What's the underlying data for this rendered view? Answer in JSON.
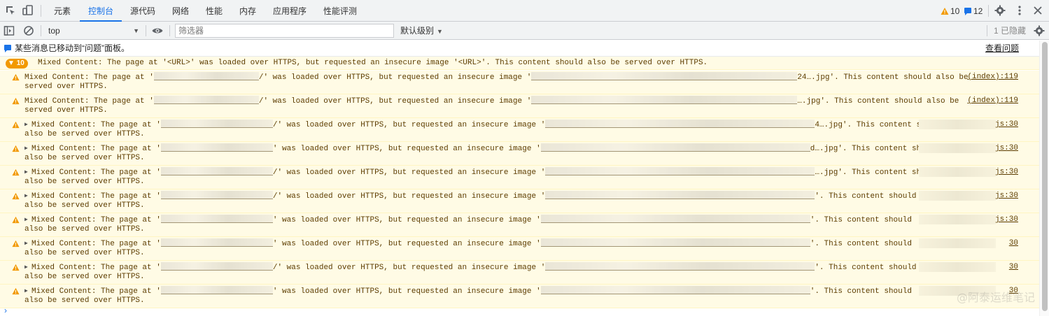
{
  "topbar": {
    "tabs": [
      {
        "label": "元素"
      },
      {
        "label": "控制台"
      },
      {
        "label": "源代码"
      },
      {
        "label": "网络"
      },
      {
        "label": "性能"
      },
      {
        "label": "内存"
      },
      {
        "label": "应用程序"
      },
      {
        "label": "性能评测"
      }
    ],
    "active_tab": "控制台",
    "warnings_count": "10",
    "issues_count": "12",
    "icons": [
      "inspect-icon",
      "device-toggle-icon",
      "warning-icon",
      "issues-flag-icon",
      "gear-icon",
      "kebab-menu-icon",
      "close-icon"
    ],
    "accent_color": "#1a73e8"
  },
  "toolbar": {
    "context": "top",
    "filter_placeholder": "筛选器",
    "levels_label": "默认级别",
    "hidden_label": "1 已隐藏",
    "icons": [
      "sidebar-toggle-icon",
      "clear-console-icon",
      "eye-icon",
      "settings-icon"
    ]
  },
  "info_banner": {
    "message": "某些消息已移动到“问题”面板。",
    "link": "查看问题"
  },
  "group": {
    "badge": "10",
    "text": "Mixed Content: The page at '<URL>' was loaded over HTTPS, but requested an insecure image '<URL>'. This content should also be served over HTTPS."
  },
  "warnings": [
    {
      "expandable": false,
      "p1": "Mixed Content: The page at '",
      "p2": "/' was loaded over HTTPS, but requested an insecure image '",
      "p3": "24….jpg'. This content should also be",
      "line2": "served over HTTPS.",
      "source": "(index):119"
    },
    {
      "expandable": false,
      "p1": "Mixed Content: The page at '",
      "p2": "/' was loaded over HTTPS, but requested an insecure image '",
      "p3": "….jpg'. This content should also be",
      "line2": "served over HTTPS.",
      "source": "(index):119"
    },
    {
      "expandable": true,
      "p1": "Mixed Content: The page at '",
      "p2": "/' was loaded over HTTPS, but requested an insecure image '",
      "p3": "4….jpg'. This content should",
      "line2": "also be served over HTTPS.",
      "source": "js:30"
    },
    {
      "expandable": true,
      "p1": "Mixed Content: The page at '",
      "p2": "' was loaded over HTTPS, but requested an insecure image '",
      "p3": "d….jpg'. This content should",
      "line2": "also be served over HTTPS.",
      "source": "js:30"
    },
    {
      "expandable": true,
      "p1": "Mixed Content: The page at '",
      "p2": "/' was loaded over HTTPS, but requested an insecure image '",
      "p3": "….jpg'. This content should",
      "line2": "also be served over HTTPS.",
      "source": "js:30"
    },
    {
      "expandable": true,
      "p1": "Mixed Content: The page at '",
      "p2": "/' was loaded over HTTPS, but requested an insecure image '",
      "p3": "'. This content should",
      "line2": "also be served over HTTPS.",
      "source": "js:30"
    },
    {
      "expandable": true,
      "p1": "Mixed Content: The page at '",
      "p2": "' was loaded over HTTPS, but requested an insecure image '",
      "p3": "'. This content should",
      "line2": "also be served over HTTPS.",
      "source": "js:30"
    },
    {
      "expandable": true,
      "p1": "Mixed Content: The page at '",
      "p2": "' was loaded over HTTPS, but requested an insecure image '",
      "p3": "'. This content should",
      "line2": "also be served over HTTPS.",
      "source": "30"
    },
    {
      "expandable": true,
      "p1": "Mixed Content: The page at '",
      "p2": "/' was loaded over HTTPS, but requested an insecure image '",
      "p3": "'. This content should",
      "line2": "also be served over HTTPS.",
      "source": "30"
    },
    {
      "expandable": true,
      "p1": "Mixed Content: The page at '",
      "p2": "' was loaded over HTTPS, but requested an insecure image '",
      "p3": "'. This content should",
      "line2": "also be served over HTTPS.",
      "source": "30"
    }
  ],
  "watermark": "@阿泰运维笔记"
}
